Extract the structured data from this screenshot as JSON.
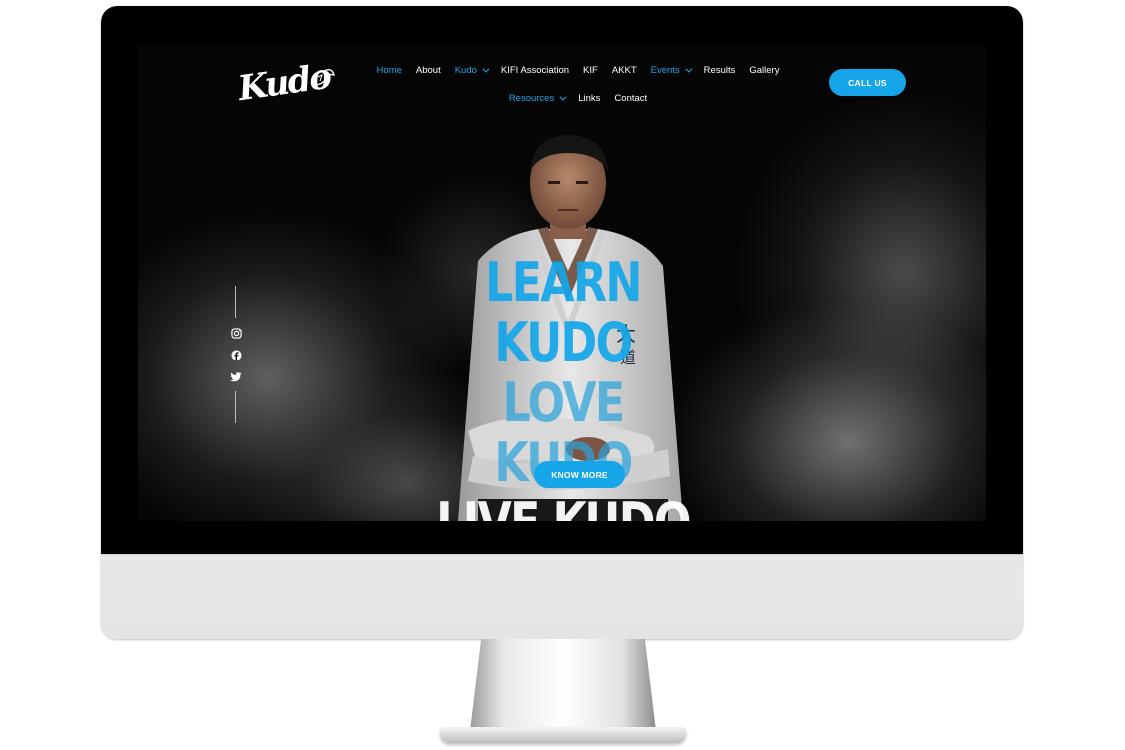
{
  "brand": {
    "logo_text": "Kudo",
    "accent_color": "#15a5e8"
  },
  "nav": {
    "row1": [
      {
        "label": "Home",
        "active": true,
        "dropdown": false
      },
      {
        "label": "About",
        "active": false,
        "dropdown": false
      },
      {
        "label": "Kudo",
        "active": true,
        "dropdown": true
      },
      {
        "label": "KIFI Association",
        "active": false,
        "dropdown": false
      },
      {
        "label": "KIF",
        "active": false,
        "dropdown": false
      },
      {
        "label": "AKKT",
        "active": false,
        "dropdown": false
      },
      {
        "label": "Events",
        "active": true,
        "dropdown": true
      },
      {
        "label": "Results",
        "active": false,
        "dropdown": false
      },
      {
        "label": "Gallery",
        "active": false,
        "dropdown": false
      }
    ],
    "row2": [
      {
        "label": "Resources",
        "active": true,
        "dropdown": true
      },
      {
        "label": "Links",
        "active": false,
        "dropdown": false
      },
      {
        "label": "Contact",
        "active": false,
        "dropdown": false
      }
    ]
  },
  "header": {
    "call_label": "CALL US"
  },
  "social": {
    "icons": [
      "instagram-icon",
      "facebook-icon",
      "twitter-icon"
    ]
  },
  "hero": {
    "line1": "LEARN KUDO",
    "line2": "LOVE KUDO",
    "line3": "LIVE KUDO",
    "cta_label": "KNOW MORE"
  }
}
